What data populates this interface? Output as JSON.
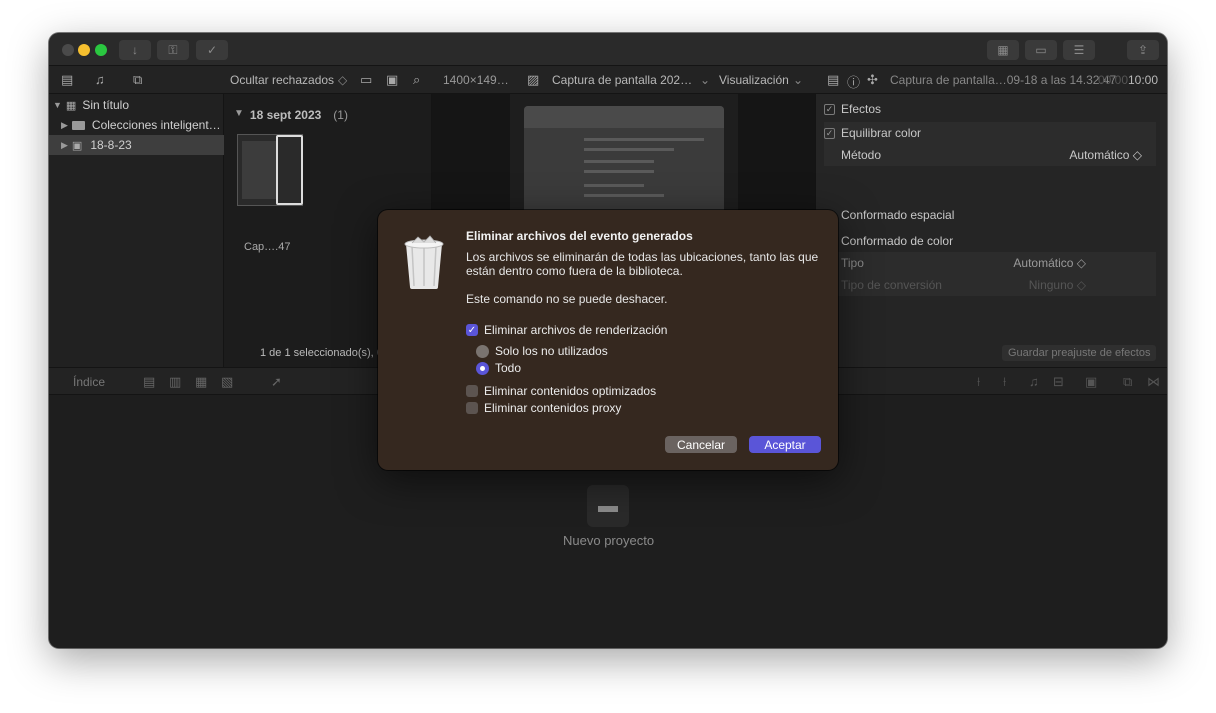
{
  "window": {
    "toolbar": {
      "hide_rejected": "Ocultar rechazados",
      "resolution": "1400×149…",
      "clip_name": "Captura de pantalla 202…",
      "view_menu": "Visualización",
      "inspector_clip": "Captura de pantalla…09-18 a las 14.32.47",
      "timecode_dim": "00:00",
      "timecode": "10:00"
    }
  },
  "sidebar": {
    "items": [
      {
        "label": "Sin título"
      },
      {
        "label": "Colecciones inteligent…"
      },
      {
        "label": "18-8-23"
      }
    ]
  },
  "browser": {
    "date_header": "18 sept 2023",
    "count": "(1)",
    "clip_label": "Cap….47",
    "status": "1 de 1 seleccionado(s), 04"
  },
  "inspector": {
    "effects": "Efectos",
    "balance_color": "Equilibrar color",
    "method_label": "Método",
    "method_value": "Automático ◇",
    "spatial": "Conformado espacial",
    "color_conform": "Conformado de color",
    "type_label": "Tipo",
    "type_value": "Automático ◇",
    "conversion_label": "Tipo de conversión",
    "conversion_value": "Ninguno ◇",
    "save_preset": "Guardar preajuste de efectos"
  },
  "bottom": {
    "index": "Índice",
    "new_project": "Nuevo proyecto"
  },
  "dialog": {
    "title": "Eliminar archivos del evento generados",
    "message": "Los archivos se eliminarán de todas las ubicaciones, tanto las que están dentro como fuera de la biblioteca.",
    "warning": "Este comando no se puede deshacer.",
    "opt_render": "Eliminar archivos de renderización",
    "opt_unused": "Solo los no utilizados",
    "opt_all": "Todo",
    "opt_optimized": "Eliminar contenidos optimizados",
    "opt_proxy": "Eliminar contenidos proxy",
    "cancel": "Cancelar",
    "accept": "Aceptar"
  },
  "colors": {
    "accent": "#5a55d8",
    "dialog_bg": "#35281f"
  }
}
